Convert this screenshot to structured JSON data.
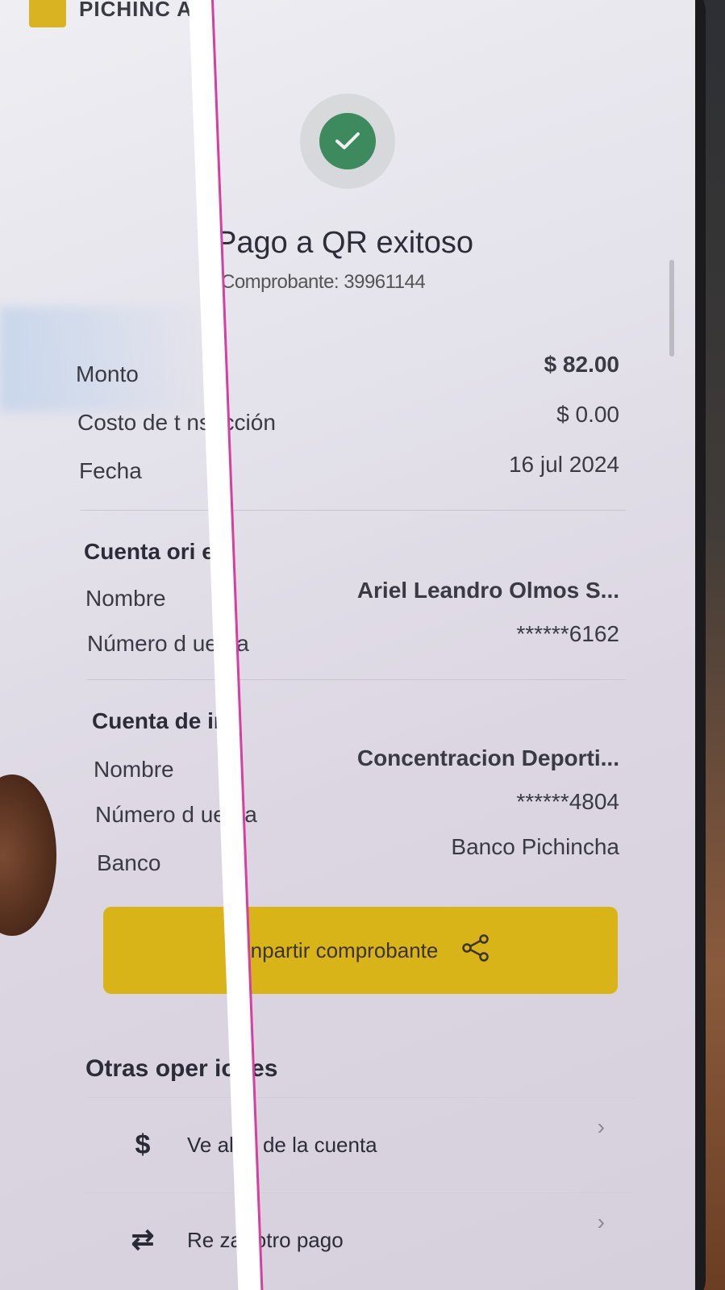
{
  "brand": {
    "name": "PICHINC A"
  },
  "status": {
    "title": "Pago a QR exitoso",
    "voucher": "Comprobante: 39961144"
  },
  "summary": [
    {
      "label": "Monto",
      "value": "$ 82.00"
    },
    {
      "label": "Costo de t nsacción",
      "value": "$ 0.00"
    },
    {
      "label": "Fecha",
      "value": "16 jul 2024"
    }
  ],
  "origin": {
    "title": "Cuenta ori en",
    "name_label": "Nombre",
    "name_value": "Ariel Leandro Olmos S...",
    "account_label": "Número d uenta",
    "account_value": "******6162"
  },
  "destination": {
    "title": "Cuenta de ino",
    "name_label": "Nombre",
    "name_value": "Concentracion Deporti...",
    "account_label": "Número d uenta",
    "account_value": "******4804",
    "bank_label": "Banco",
    "bank_value": "Banco Pichincha"
  },
  "share_button": {
    "label": "C npartir comprobante"
  },
  "other_ops": {
    "title": "Otras oper iones",
    "items": [
      {
        "icon": "dollar-icon",
        "glyph": "$",
        "label": "Ve aldo de la cuenta"
      },
      {
        "icon": "transfer-icon",
        "glyph": "⇄",
        "label": "Re zar otro pago"
      }
    ]
  },
  "colors": {
    "success": "#3c8a5e",
    "brand_yellow": "#d8b418"
  }
}
